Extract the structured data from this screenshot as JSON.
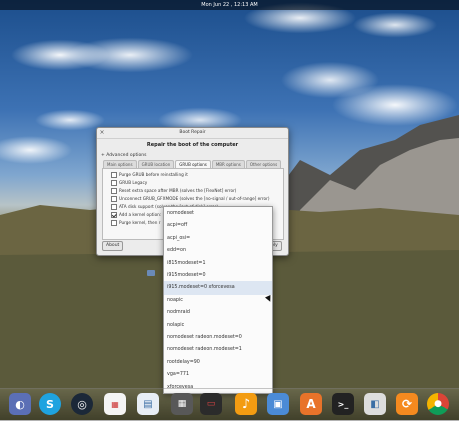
{
  "topbar": {
    "clock": "Mon Jun 22 , 12:13 AM"
  },
  "window": {
    "title": "Boot Repair",
    "heading": "Repair the boot of the computer",
    "advanced_toggle": "+ Advanced options",
    "tabs": [
      "Main options",
      "GRUB location",
      "GRUB options",
      "MBR options",
      "Other options"
    ],
    "options": [
      {
        "label": "Purge GRUB before reinstalling it",
        "checked": false
      },
      {
        "label": "GRUB Legacy",
        "checked": false
      },
      {
        "label": "Reset extra space after MBR (solves the [FlexNet] error)",
        "checked": false
      },
      {
        "label": "Unconnect GRUB_GFXMODE (solves the [no-signal / out-of-range] error)",
        "checked": false
      },
      {
        "label": "ATA disk support (solves the [out-of-disk] error)",
        "checked": false
      },
      {
        "label": "Add a kernel option:",
        "checked": true
      },
      {
        "label": "Purge kernel, then r",
        "checked": false
      }
    ],
    "about_label": "About",
    "apply_label": "ply"
  },
  "dropdown": {
    "items": [
      "nomodeset",
      "acpi=off",
      "acpi_osi=",
      "edd=on",
      "i815modeset=1",
      "i915modeset=0",
      "i915.modeset=0 xforcevesa",
      "noapic",
      "nodmraid",
      "nolapic",
      "nomodeset radeon.modeset=0",
      "nomodeset radeon.modeset=1",
      "rootdelay=90",
      "vga=771",
      "xforcevesa"
    ],
    "highlighted": 6
  },
  "dock": {
    "icons": [
      "finder-icon",
      "skype-icon",
      "steam-icon",
      "calendar-icon",
      "document-icon",
      "calculator-icon",
      "terminal-monitor-icon",
      "music-icon",
      "photos-icon",
      "software-center-icon",
      "terminal-icon",
      "toggle-icon",
      "update-icon",
      "chrome-icon"
    ]
  }
}
